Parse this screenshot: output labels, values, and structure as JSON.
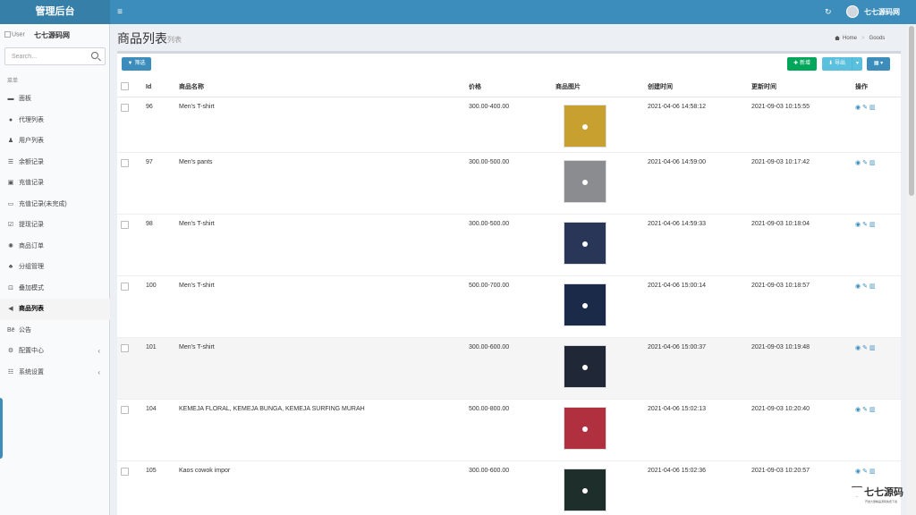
{
  "header": {
    "logo": "管理后台",
    "menu_toggle": "≡",
    "refresh_icon": "↻",
    "user_name": "七七源码网"
  },
  "sidebar": {
    "user_image_alt": "User",
    "site_name": "七七源码网",
    "search_placeholder": "Search...",
    "menu_header": "菜单",
    "items": [
      {
        "label": "面板",
        "icon": "dashboard-icon",
        "glyph": "▬"
      },
      {
        "label": "代理列表",
        "icon": "circle-icon",
        "glyph": "●"
      },
      {
        "label": "用户列表",
        "icon": "user-icon",
        "glyph": "♟"
      },
      {
        "label": "余额记录",
        "icon": "list-icon",
        "glyph": "☰"
      },
      {
        "label": "充值记录",
        "icon": "card-icon",
        "glyph": "▣"
      },
      {
        "label": "充值记录(未完成)",
        "icon": "card-outline-icon",
        "glyph": "▭"
      },
      {
        "label": "提现记录",
        "icon": "edit-icon",
        "glyph": "☑"
      },
      {
        "label": "商品订单",
        "icon": "gear-icon",
        "glyph": "✺"
      },
      {
        "label": "分组管理",
        "icon": "users-icon",
        "glyph": "♣"
      },
      {
        "label": "叠加模式",
        "icon": "desktop-icon",
        "glyph": "⊡"
      },
      {
        "label": "商品列表",
        "icon": "bullhorn-icon",
        "glyph": "◀"
      },
      {
        "label": "公告",
        "icon": "behance-icon",
        "glyph": "Bē"
      },
      {
        "label": "配置中心",
        "icon": "cog-icon",
        "glyph": "⚙"
      },
      {
        "label": "系统设置",
        "icon": "list-alt-icon",
        "glyph": "☷"
      }
    ]
  },
  "content": {
    "title": "商品列表",
    "subtitle": "列表",
    "breadcrumb_home": "Home",
    "breadcrumb_current": "Goods"
  },
  "toolbar": {
    "filter": "筛选",
    "add": "新增",
    "export": "导出"
  },
  "table": {
    "columns": [
      "Id",
      "商品名称",
      "价格",
      "商品图片",
      "创建时间",
      "更新时间",
      "操作"
    ],
    "rows": [
      {
        "id": "96",
        "name": "Men's T-shirt",
        "price": "300.00-400.00",
        "created": "2021-04-06 14:58:12",
        "updated": "2021-09-03 10:15:55",
        "thumb_color": "#c8a030"
      },
      {
        "id": "97",
        "name": "Men's pants",
        "price": "300.00-500.00",
        "created": "2021-04-06 14:59:00",
        "updated": "2021-09-03 10:17:42",
        "thumb_color": "#8a8c90"
      },
      {
        "id": "98",
        "name": "Men's T-shirt",
        "price": "300.00-500.00",
        "created": "2021-04-06 14:59:33",
        "updated": "2021-09-03 10:18:04",
        "thumb_color": "#2a3658"
      },
      {
        "id": "100",
        "name": "Men's T-shirt",
        "price": "500.00-700.00",
        "created": "2021-04-06 15:00:14",
        "updated": "2021-09-03 10:18:57",
        "thumb_color": "#1c2a4a"
      },
      {
        "id": "101",
        "name": "Men's T-shirt",
        "price": "300.00-600.00",
        "created": "2021-04-06 15:00:37",
        "updated": "2021-09-03 10:19:48",
        "thumb_color": "#202838"
      },
      {
        "id": "104",
        "name": "KEMEJA FLORAL, KEMEJA BUNGA, KEMEJA SURFING MURAH",
        "price": "500.00-800.00",
        "created": "2021-04-06 15:02:13",
        "updated": "2021-09-03 10:20:40",
        "thumb_color": "#b03040"
      },
      {
        "id": "105",
        "name": "Kaos cowok impor",
        "price": "300.00-600.00",
        "created": "2021-04-06 15:02:36",
        "updated": "2021-09-03 10:20:57",
        "thumb_color": "#1e2e2a"
      }
    ]
  },
  "watermark": {
    "text": "七七源码",
    "sub": "开发大量精品源码免费下载"
  },
  "colors": {
    "brand": "#3c8dbc",
    "success": "#00a65a",
    "info": "#5bc0de"
  }
}
